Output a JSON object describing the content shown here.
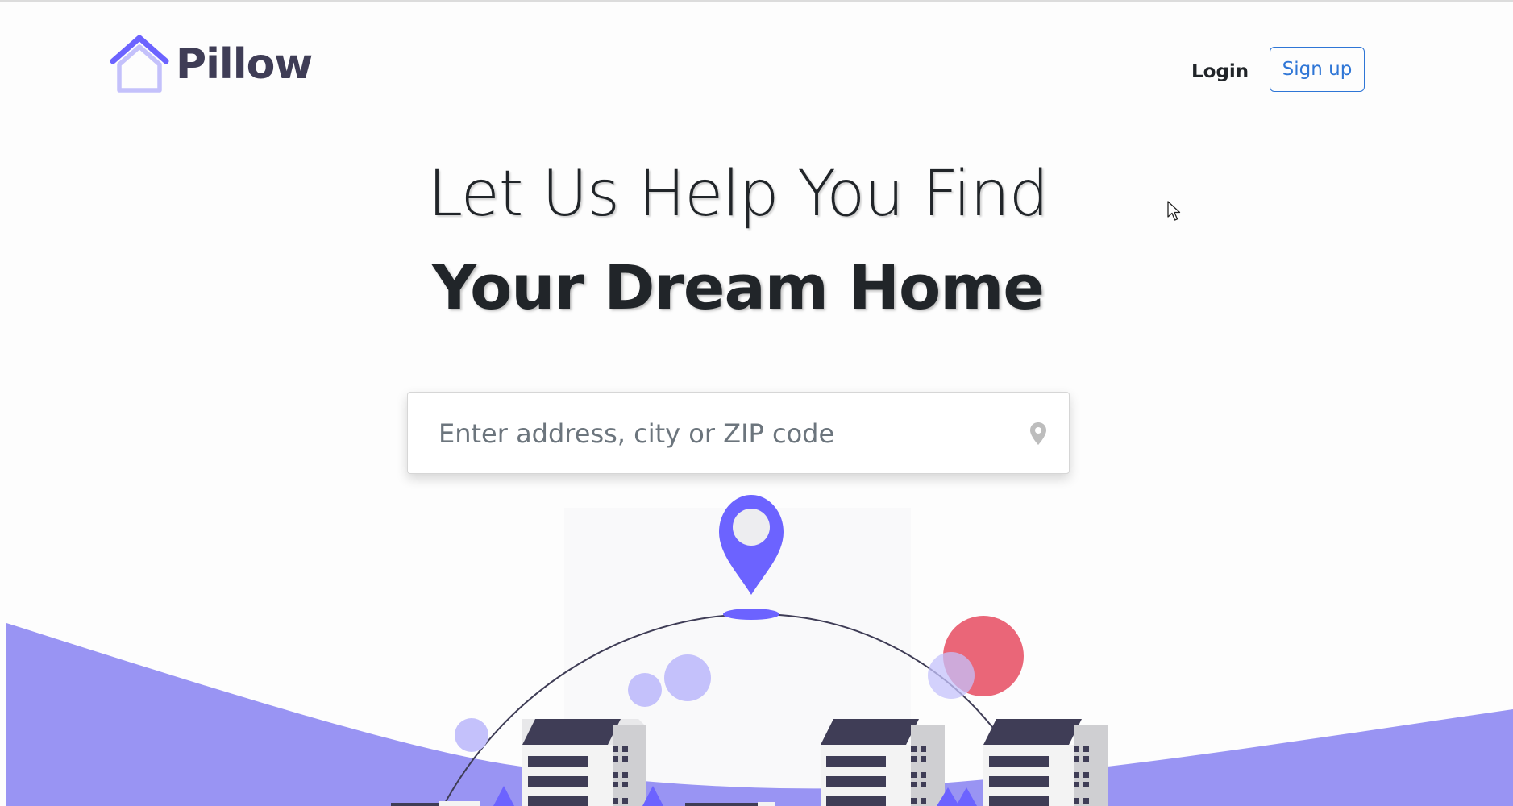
{
  "header": {
    "logo_text": "Pillow",
    "login_label": "Login",
    "signup_label": "Sign up"
  },
  "hero": {
    "line1": "Let Us Help You Find",
    "line2": "Your Dream Home"
  },
  "search": {
    "placeholder": "Enter address, city or ZIP code",
    "value": ""
  },
  "icons": {
    "logo": "house-logo-icon",
    "search_pin": "map-pin-icon",
    "illustration_pin": "location-marker-icon"
  },
  "colors": {
    "brand_purple": "#6c63ff",
    "wave": "#9994f3",
    "light_purple": "#c4c1fb",
    "accent_red": "#ea6678",
    "dark_roof": "#3f3d56",
    "link_blue": "#2f76d6",
    "text_dark": "#212529"
  }
}
